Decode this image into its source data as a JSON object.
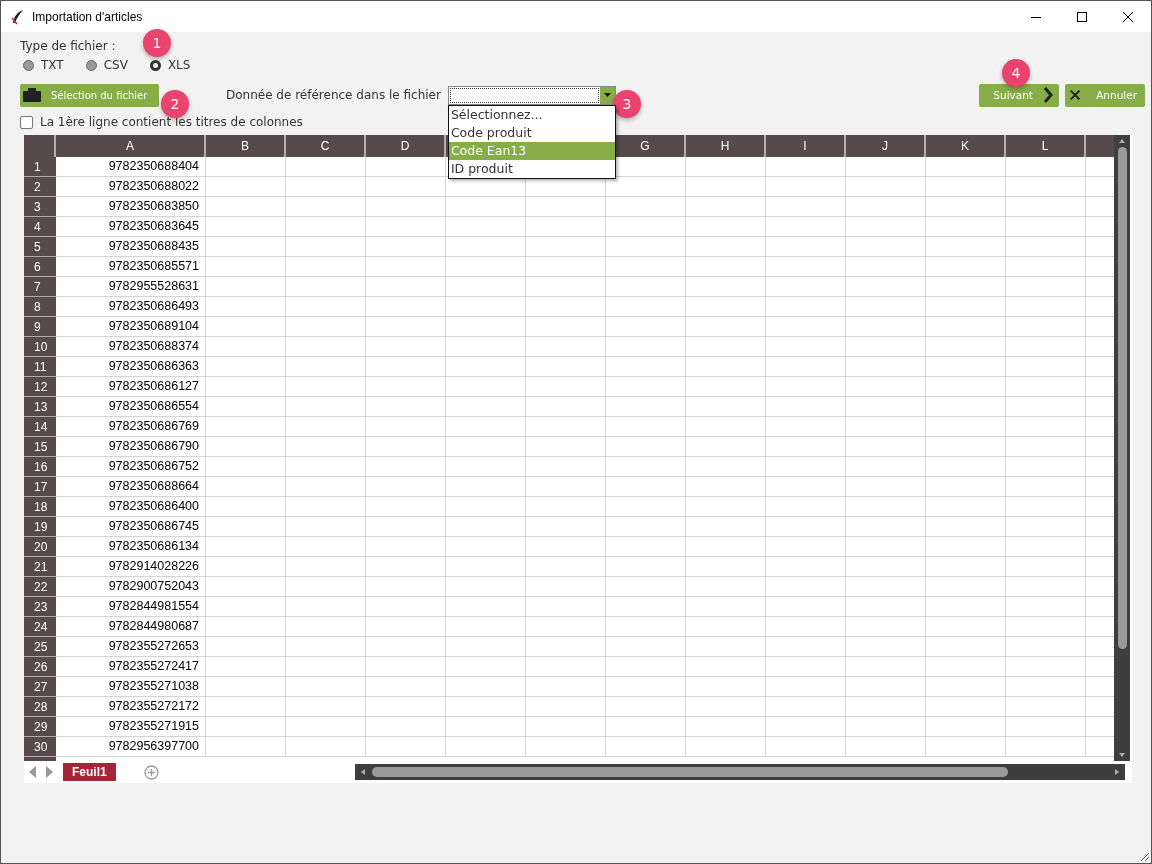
{
  "window": {
    "title": "Importation d'articles"
  },
  "file_type": {
    "label": "Type de fichier :",
    "options": [
      {
        "label": "TXT",
        "selected": false
      },
      {
        "label": "CSV",
        "selected": false
      },
      {
        "label": "XLS",
        "selected": true
      }
    ]
  },
  "select_file_button": "Sélection du fichier",
  "reference": {
    "label": "Donnée de référence dans le fichier",
    "expanded": true,
    "options": [
      {
        "label": "Sélectionnez...",
        "selected": false
      },
      {
        "label": "Code produit",
        "selected": false
      },
      {
        "label": "Code Ean13",
        "selected": true
      },
      {
        "label": "ID produit",
        "selected": false
      }
    ]
  },
  "buttons": [
    {
      "kind": "next",
      "label": "Suivant"
    },
    {
      "kind": "cancel",
      "label": "Annuler"
    }
  ],
  "header_row_checkbox": {
    "label": "La 1ère ligne contient les titres de colonnes",
    "checked": false
  },
  "badges": [
    "1",
    "2",
    "3",
    "4"
  ],
  "table": {
    "columns": [
      "A",
      "B",
      "C",
      "D",
      null,
      null,
      "G",
      "H",
      "I",
      "J",
      "K",
      "L"
    ],
    "rows": [
      {
        "number": "1",
        "a": "9782350688404"
      },
      {
        "number": "2",
        "a": "9782350688022"
      },
      {
        "number": "3",
        "a": "9782350683850"
      },
      {
        "number": "4",
        "a": "9782350683645"
      },
      {
        "number": "5",
        "a": "9782350688435"
      },
      {
        "number": "6",
        "a": "9782350685571"
      },
      {
        "number": "7",
        "a": "9782955528631"
      },
      {
        "number": "8",
        "a": "9782350686493"
      },
      {
        "number": "9",
        "a": "9782350689104"
      },
      {
        "number": "10",
        "a": "9782350688374"
      },
      {
        "number": "11",
        "a": "9782350686363"
      },
      {
        "number": "12",
        "a": "9782350686127"
      },
      {
        "number": "13",
        "a": "9782350686554"
      },
      {
        "number": "14",
        "a": "9782350686769"
      },
      {
        "number": "15",
        "a": "9782350686790"
      },
      {
        "number": "16",
        "a": "9782350686752"
      },
      {
        "number": "17",
        "a": "9782350688664"
      },
      {
        "number": "18",
        "a": "9782350686400"
      },
      {
        "number": "19",
        "a": "9782350686745"
      },
      {
        "number": "20",
        "a": "9782350686134"
      },
      {
        "number": "21",
        "a": "9782914028226"
      },
      {
        "number": "22",
        "a": "9782900752043"
      },
      {
        "number": "23",
        "a": "9782844981554"
      },
      {
        "number": "24",
        "a": "9782844980687"
      },
      {
        "number": "25",
        "a": "9782355272653"
      },
      {
        "number": "26",
        "a": "9782355272417"
      },
      {
        "number": "27",
        "a": "9782355271038"
      },
      {
        "number": "28",
        "a": "9782355272172"
      },
      {
        "number": "29",
        "a": "9782355271915"
      },
      {
        "number": "30",
        "a": "9782956397700"
      }
    ]
  },
  "sheet_tabs": [
    {
      "label": "Feuil1",
      "selected": true
    }
  ]
}
